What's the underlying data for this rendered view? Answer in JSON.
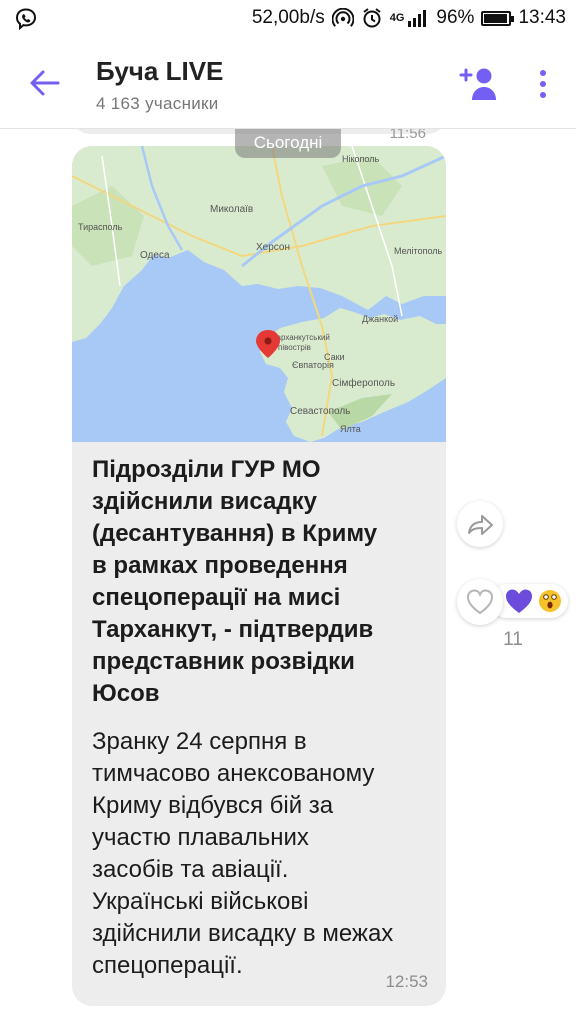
{
  "status_bar": {
    "speed": "52,00b/s",
    "network": "4G",
    "battery": "96%",
    "battery_level": 0.96,
    "time": "13:43"
  },
  "header": {
    "title": "Буча LIVE",
    "subtitle": "4 163 учасники"
  },
  "chat": {
    "previous_time": "11:56",
    "date_chip": "Сьогодні",
    "message": {
      "map_labels": {
        "tiraspol": "Тирасполь",
        "mykolaiv": "Миколаїв",
        "odesa": "Одеса",
        "kherson": "Херсон",
        "nikopol": "Нікополь",
        "melitopol": "Мелітополь",
        "dzhankoi": "Джанкой",
        "tarkhankut_1": "Тарханкутський",
        "tarkhankut_2": "півострів",
        "saky": "Саки",
        "yevpatoriia": "Євпаторія",
        "simferopol": "Сімферополь",
        "sevastopol": "Севастополь",
        "yalta": "Ялта"
      },
      "headline_lines": [
        "Підрозділи ГУР МО",
        "здійснили висадку",
        "(десантування) в Криму",
        "в рамках проведення",
        "спецоперації на мисі",
        "Тарханкут, - підтвердив",
        "представник розвідки",
        "Юсов"
      ],
      "body_lines": [
        "Зранку 24 серпня в",
        "тимчасово анексованому",
        "Криму відбувся бій за",
        "участю плавальних",
        "засобів та авіації.",
        "Українські військові",
        "здійснили висадку в межах",
        "спецоперації."
      ],
      "time": "12:53"
    },
    "reactions": {
      "count": "11",
      "items": [
        "purple-heart",
        "astonished-face"
      ]
    }
  },
  "colors": {
    "accent": "#7360f2",
    "bubble": "#ededed",
    "sea": "#a8c9f5",
    "land": "#d9ebcf",
    "pin": "#e53935"
  }
}
